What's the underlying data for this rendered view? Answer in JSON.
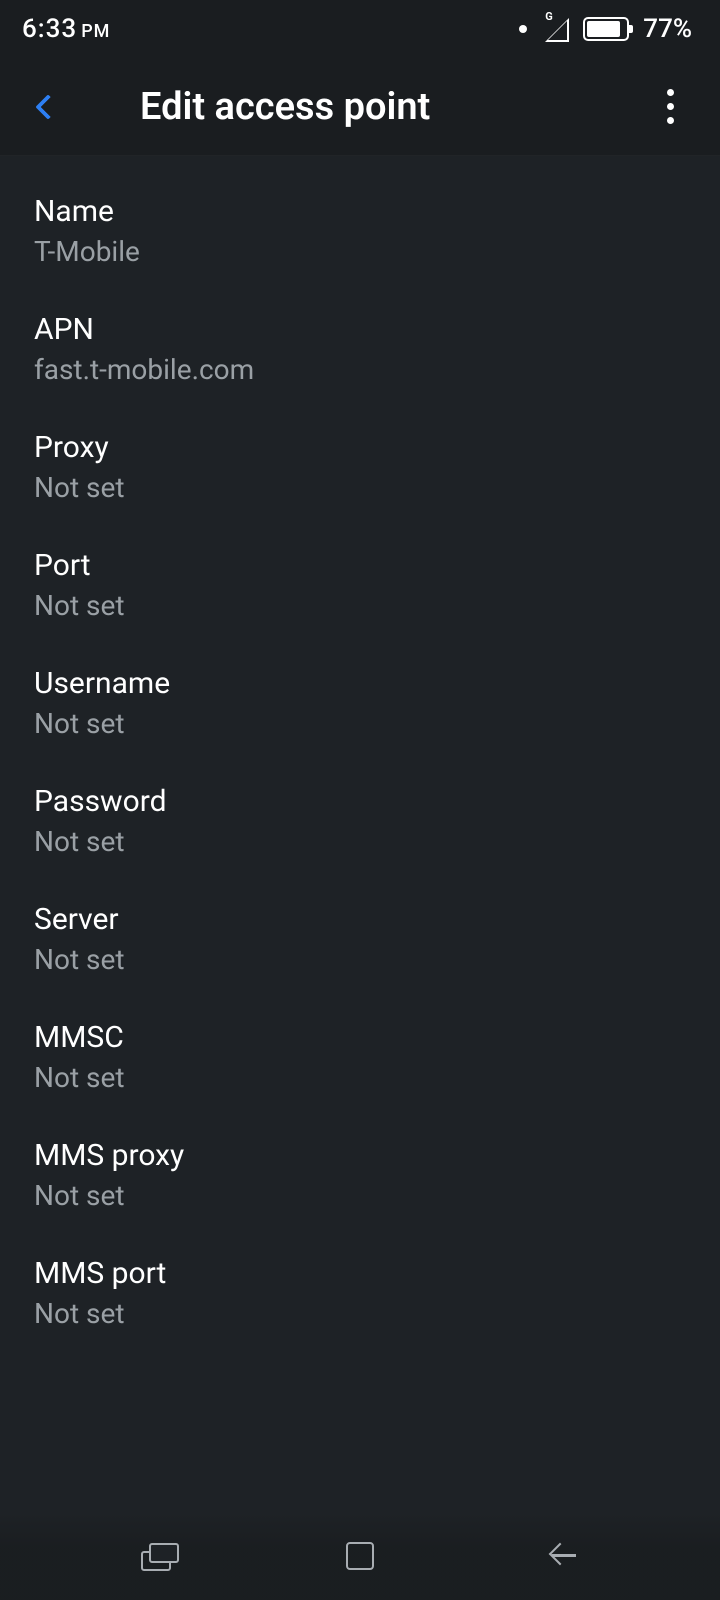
{
  "statusbar": {
    "time": "6:33",
    "ampm": "PM",
    "battery_pct": "77%"
  },
  "appbar": {
    "title": "Edit access point"
  },
  "settings": [
    {
      "label": "Name",
      "value": "T-Mobile"
    },
    {
      "label": "APN",
      "value": "fast.t-mobile.com"
    },
    {
      "label": "Proxy",
      "value": "Not set"
    },
    {
      "label": "Port",
      "value": "Not set"
    },
    {
      "label": "Username",
      "value": "Not set"
    },
    {
      "label": "Password",
      "value": "Not set"
    },
    {
      "label": "Server",
      "value": "Not set"
    },
    {
      "label": "MMSC",
      "value": "Not set"
    },
    {
      "label": "MMS proxy",
      "value": "Not set"
    },
    {
      "label": "MMS port",
      "value": "Not set"
    }
  ]
}
